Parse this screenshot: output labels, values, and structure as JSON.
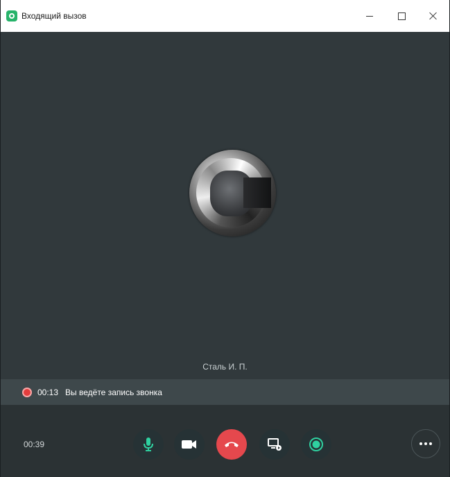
{
  "window": {
    "title": "Входящий вызов"
  },
  "call": {
    "caller_name": "Сталь И. П.",
    "recording": {
      "time": "00:13",
      "text": "Вы ведёте запись звонка"
    },
    "elapsed": "00:39"
  },
  "colors": {
    "accent": "#27b36a",
    "hangup": "#e5484d",
    "recording_dot": "#e33d3d",
    "mic_icon": "#2fd1a0"
  },
  "icons": {
    "app": "app-logo-icon",
    "minimize": "minimize-icon",
    "maximize": "maximize-icon",
    "close": "close-icon",
    "mic": "microphone-icon",
    "camera": "video-camera-icon",
    "hangup": "phone-hangup-icon",
    "screen": "screen-share-icon",
    "record": "record-icon",
    "more": "more-dots-icon",
    "recording_indicator": "recording-dot-icon"
  }
}
